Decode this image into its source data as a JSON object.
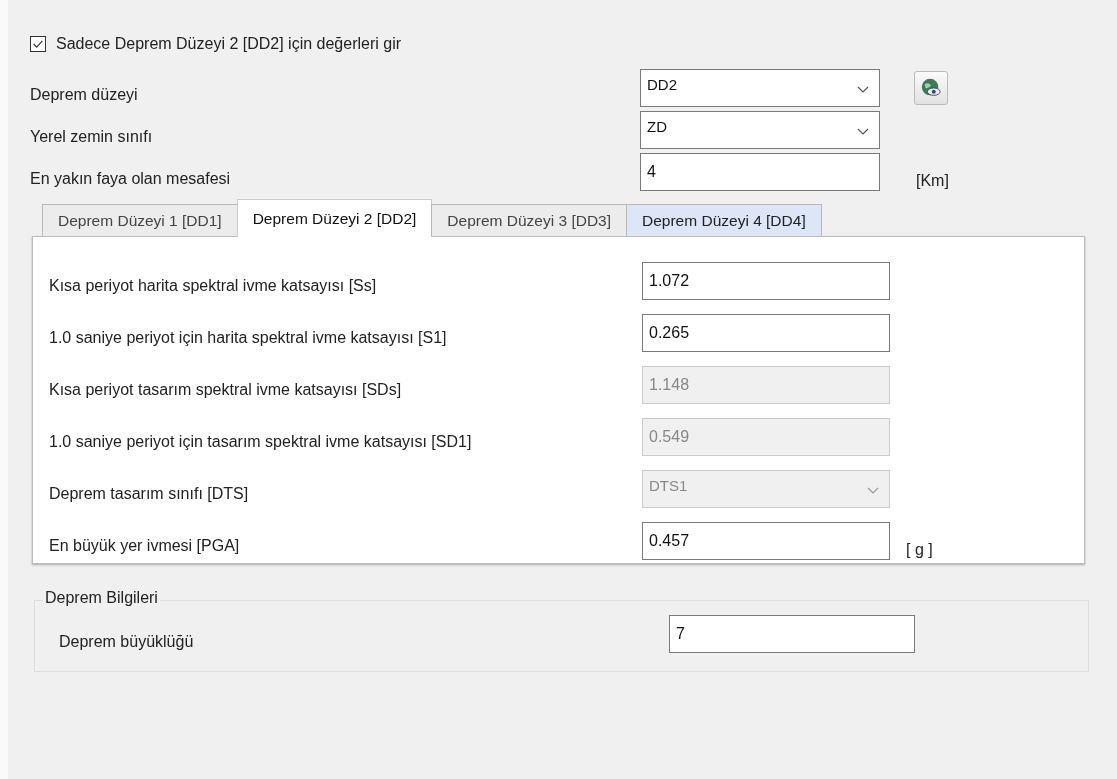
{
  "only_dd2": {
    "label": "Sadece Deprem Düzeyi 2 [DD2] için değerleri gir",
    "checked": true
  },
  "top_rows": [
    {
      "label": "Deprem düzeyi",
      "kind": "select",
      "value": "DD2",
      "button": true
    },
    {
      "label": "Yerel zemin sınıfı",
      "kind": "select",
      "value": "ZD"
    },
    {
      "label": "En yakın faya olan mesafesi",
      "kind": "input",
      "value": "4",
      "unit": "[Km]"
    }
  ],
  "tabs": [
    {
      "label": "Deprem Düzeyi 1 [DD1]",
      "selected": false,
      "highlighted": false
    },
    {
      "label": "Deprem Düzeyi 2 [DD2]",
      "selected": true,
      "highlighted": false
    },
    {
      "label": "Deprem Düzeyi 3 [DD3]",
      "selected": false,
      "highlighted": false
    },
    {
      "label": "Deprem Düzeyi 4 [DD4]",
      "selected": false,
      "highlighted": true
    }
  ],
  "tab_rows": [
    {
      "label": "Kısa periyot harita spektral ivme katsayısı [Ss]",
      "kind": "input",
      "value": "1.072",
      "disabled": false
    },
    {
      "label": "1.0 saniye periyot için harita spektral ivme katsayısı [S1]",
      "kind": "input",
      "value": "0.265",
      "disabled": false
    },
    {
      "label": "Kısa periyot tasarım spektral ivme katsayısı  [SDs]",
      "kind": "input",
      "value": "1.148",
      "disabled": true
    },
    {
      "label": "1.0 saniye periyot için tasarım spektral ivme katsayısı [SD1]",
      "kind": "input",
      "value": "0.549",
      "disabled": true
    },
    {
      "label": "Deprem tasarım sınıfı [DTS]",
      "kind": "select",
      "value": "DTS1",
      "disabled": true
    },
    {
      "label": "En büyük yer ivmesi [PGA]",
      "kind": "input",
      "value": "0.457",
      "disabled": false,
      "unit": "[ g ]"
    }
  ],
  "group": {
    "title": "Deprem Bilgileri",
    "rows": [
      {
        "label": "Deprem büyüklüğü",
        "kind": "input",
        "value": "7"
      }
    ]
  }
}
